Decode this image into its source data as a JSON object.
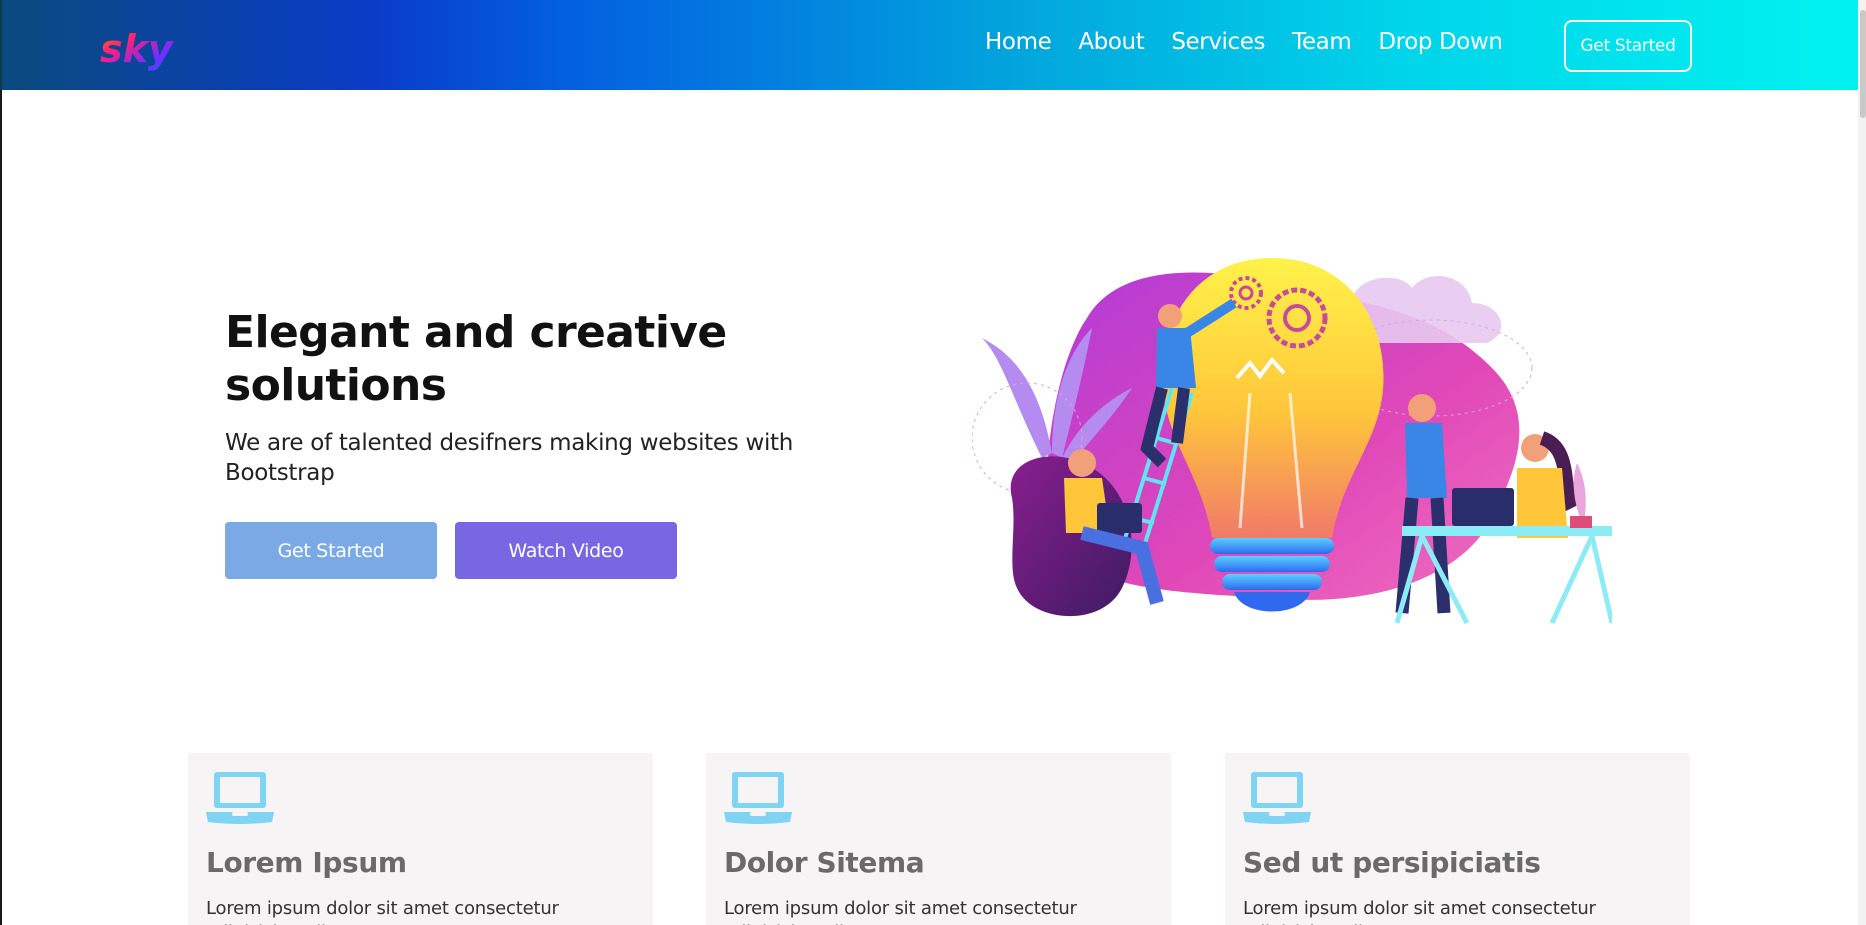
{
  "header": {
    "logo_text": "sky",
    "nav": [
      "Home",
      "About",
      "Services",
      "Team",
      "Drop Down"
    ],
    "cta_label": "Get Started"
  },
  "hero": {
    "title": "Elegant and creative solutions",
    "subtitle": "We are of talented desifners making websites with Bootstrap",
    "primary_label": "Get Started",
    "secondary_label": "Watch Video"
  },
  "cards": [
    {
      "title": "Lorem Ipsum",
      "text": "Lorem ipsum dolor sit amet consectetur adipisicing elit. Aut ...",
      "icon": "laptop-icon"
    },
    {
      "title": "Dolor Sitema",
      "text": "Lorem ipsum dolor sit amet consectetur adipisicing elit. Aut ...",
      "icon": "laptop-icon"
    },
    {
      "title": "Sed ut persipiciatis",
      "text": "Lorem ipsum dolor sit amet consectetur adipisicing elit. Aut ...",
      "icon": "laptop-icon"
    }
  ],
  "colors": {
    "accent_primary": "#7aa9e6",
    "accent_secondary": "#7767e3",
    "icon": "#7fd3f3",
    "card_bg": "#f6f4f4"
  }
}
